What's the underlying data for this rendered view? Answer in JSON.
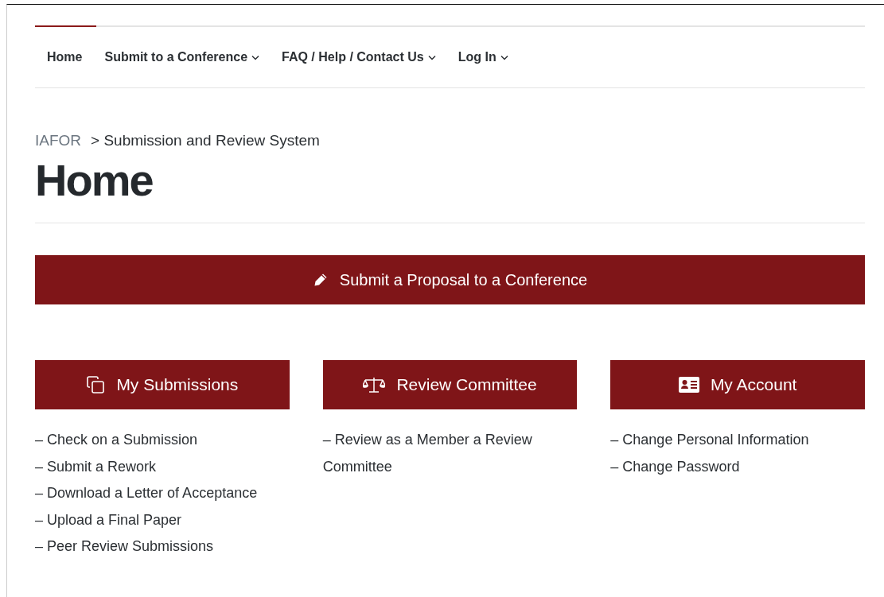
{
  "nav": [
    {
      "label": "Home",
      "kind": "link"
    },
    {
      "label": "Submit to a Conference",
      "kind": "dropdown"
    },
    {
      "label": "FAQ / Help / Contact Us",
      "kind": "dropdown"
    },
    {
      "label": "Log In",
      "kind": "dropdown"
    }
  ],
  "breadcrumb": {
    "root": "IAFOR",
    "current": "> Submission and Review System"
  },
  "title": "Home",
  "main_button": "Submit a Proposal to a Conference",
  "sections": [
    {
      "title": "My Submissions",
      "links": [
        "– Check on a Submission",
        "– Submit a Rework",
        "– Download a Letter of Acceptance",
        "– Upload a Final Paper",
        "– Peer Review Submissions"
      ]
    },
    {
      "title": "Review Committee",
      "links": [
        "– Review as a Member a Review Committee"
      ]
    },
    {
      "title": "My Account",
      "links": [
        "– Change Personal Information",
        "– Change Password"
      ]
    }
  ]
}
